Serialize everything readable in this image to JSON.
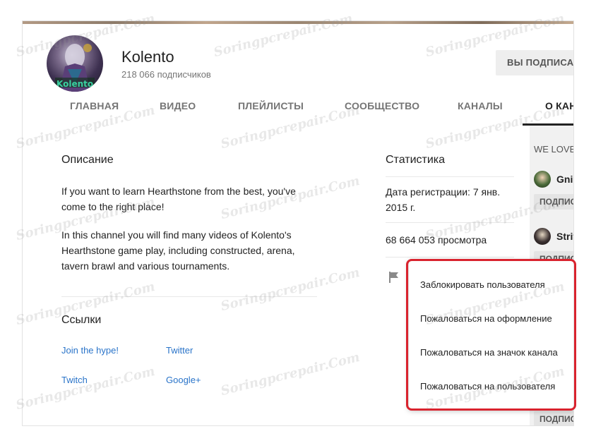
{
  "channel": {
    "name": "Kolento",
    "subscribers": "218 066 подписчиков",
    "subscribe_button": "ВЫ ПОДПИСАНЫ"
  },
  "tabs": [
    {
      "label": "ГЛАВНАЯ"
    },
    {
      "label": "ВИДЕО"
    },
    {
      "label": "ПЛЕЙЛИСТЫ"
    },
    {
      "label": "СООБЩЕСТВО"
    },
    {
      "label": "КАНАЛЫ"
    },
    {
      "label": "О КАНАЛЕ",
      "active": true
    }
  ],
  "description": {
    "title": "Описание",
    "paragraph1": "If you want to learn Hearthstone from the best, you've come to the right place!",
    "paragraph2": "In this channel you will find many videos of Kolento's Hearthstone game play, including constructed, arena, tavern brawl and various tournaments."
  },
  "links": {
    "title": "Ссылки",
    "items": [
      "Join the hype!",
      "Twitter",
      "Twitch",
      "Google+"
    ]
  },
  "stats": {
    "title": "Статистика",
    "registration": "Дата регистрации: 7 янв. 2015 г.",
    "views": "68 664 053 просмотра"
  },
  "sidebar": {
    "title": "WE LOVE",
    "channels": [
      {
        "name": "Gnim",
        "subscribe": "ПОДПИСАТЬСЯ"
      },
      {
        "name": "Strif",
        "subscribe": "ПОДПИСАТЬСЯ"
      }
    ],
    "bottom_subscribe": "ПОДПИСАТЬСЯ"
  },
  "menu": {
    "items": [
      "Заблокировать пользователя",
      "Пожаловаться на оформление",
      "Пожаловаться на значок канала",
      "Пожаловаться на пользователя"
    ]
  },
  "icons": {
    "flag": "flag-icon"
  },
  "colors": {
    "link": "#2a74c9",
    "highlight": "#d9232e",
    "background": "#f1f1f1"
  },
  "watermark": "Soringpcrepair.Com"
}
